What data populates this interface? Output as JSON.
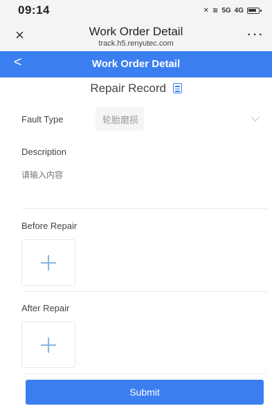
{
  "status_bar": {
    "time": "09:14",
    "signal_5g": "5G",
    "signal_4g": "4G"
  },
  "browser": {
    "title": "Work Order Detail",
    "url": "track.h5.renyutec.com",
    "more": "···",
    "close": "×"
  },
  "nav": {
    "title": "Work Order Detail",
    "back": "<"
  },
  "page": {
    "section_title": "Repair Record"
  },
  "form": {
    "fault_type_label": "Fault Type",
    "fault_type_value": "轮胎磨损",
    "description_label": "Description",
    "description_placeholder": "请输入内容",
    "before_repair_label": "Before Repair",
    "after_repair_label": "After Repair",
    "submit_label": "Submit"
  },
  "colors": {
    "primary": "#3b7ef0",
    "plus": "#8ab2e6"
  },
  "icons": {
    "close": "close-icon",
    "more": "more-icon",
    "back": "back-icon",
    "doc": "document-icon",
    "chevron": "chevron-down-icon",
    "plus": "plus-icon"
  }
}
